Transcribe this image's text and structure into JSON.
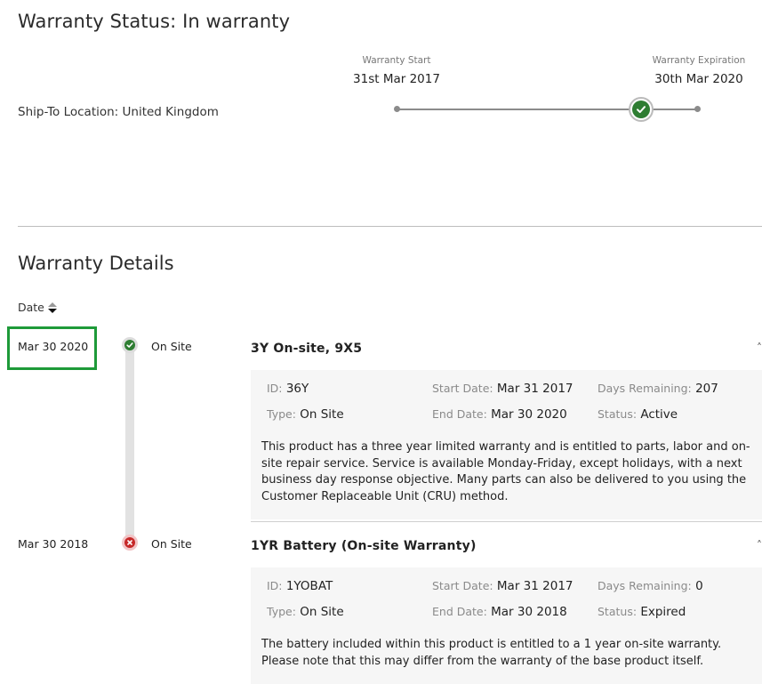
{
  "status": {
    "title": "Warranty Status: In warranty",
    "ship_to": "Ship-To Location: United Kingdom",
    "start_label": "Warranty Start",
    "start_date": "31st Mar 2017",
    "end_label": "Warranty Expiration",
    "end_date": "30th Mar 2020",
    "current_icon": "check-circle-icon"
  },
  "details": {
    "title": "Warranty Details",
    "sort_label": "Date",
    "rows": [
      {
        "date": "Mar 30 2020",
        "type": "On Site",
        "status_icon": "check-circle-icon",
        "name": "3Y On-site, 9X5",
        "id_label": "ID:",
        "id": "36Y",
        "start_label": "Start Date:",
        "start": "Mar 31 2017",
        "days_label": "Days Remaining:",
        "days": "207",
        "type_label": "Type:",
        "type_value": "On Site",
        "end_label": "End Date:",
        "end": "Mar 30 2020",
        "status_label": "Status:",
        "status": "Active",
        "description": "This product has a three year limited warranty and is entitled to parts, labor and on-site repair service. Service is available Monday-Friday, except holidays, with a next business day response objective. Many parts can also be delivered to you using the Customer Replaceable Unit (CRU) method."
      },
      {
        "date": "Mar 30 2018",
        "type": "On Site",
        "status_icon": "x-circle-icon",
        "name": "1YR Battery (On-site Warranty)",
        "id_label": "ID:",
        "id": "1YOBAT",
        "start_label": "Start Date:",
        "start": "Mar 31 2017",
        "days_label": "Days Remaining:",
        "days": "0",
        "type_label": "Type:",
        "type_value": "On Site",
        "end_label": "End Date:",
        "end": "Mar 30 2018",
        "status_label": "Status:",
        "status": "Expired",
        "description": "The battery included within this product is entitled to a 1 year on-site warranty. Please note that this may differ from the warranty of the base product itself."
      }
    ]
  },
  "colors": {
    "active_green": "#2e7d32",
    "expired_red": "#c62828",
    "highlight_green": "#1e9a39",
    "panel_bg": "#f6f6f6"
  }
}
